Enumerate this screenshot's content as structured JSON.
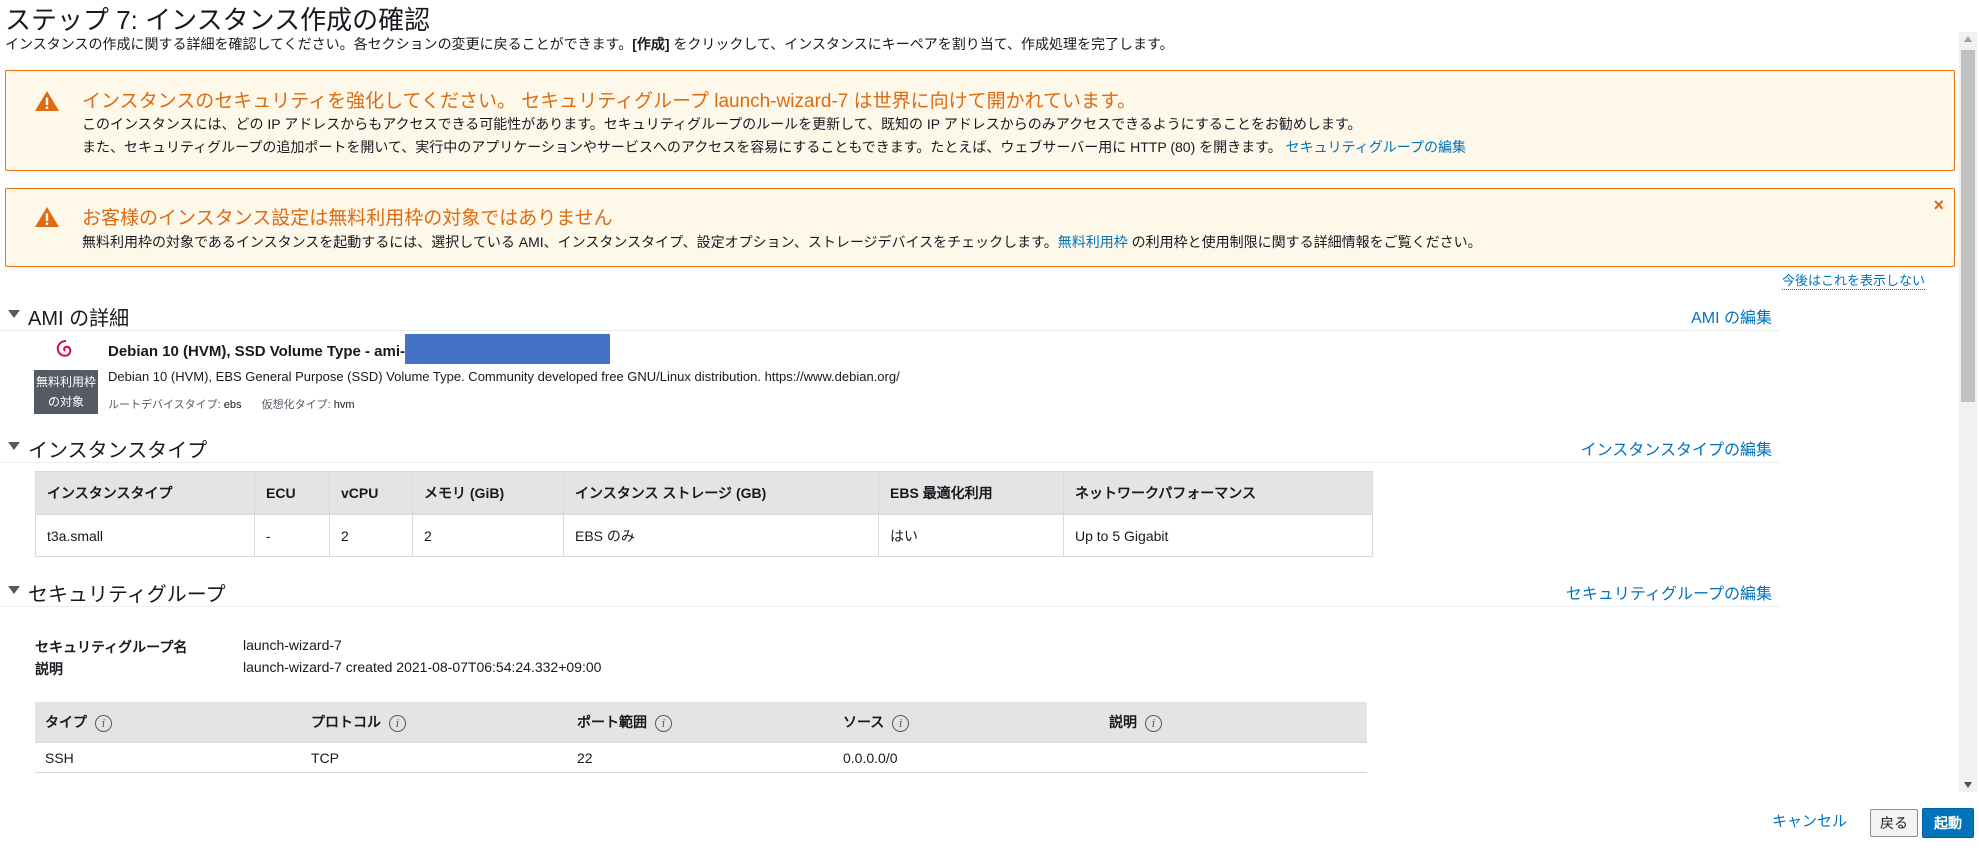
{
  "page": {
    "title": "ステップ 7: インスタンス作成の確認",
    "subtitle_pre": "インスタンスの作成に関する詳細を確認してください。各セクションの変更に戻ることができます。",
    "subtitle_bold": "[作成]",
    "subtitle_post": " をクリックして、インスタンスにキーペアを割り当て、作成処理を完了します。"
  },
  "alerts": {
    "security": {
      "title": "インスタンスのセキュリティを強化してください。 セキュリティグループ launch-wizard-7 は世界に向けて開かれています。",
      "line1": "このインスタンスには、どの IP アドレスからもアクセスできる可能性があります。セキュリティグループのルールを更新して、既知の IP アドレスからのみアクセスできるようにすることをお勧めします。",
      "line2": "また、セキュリティグループの追加ポートを開いて、実行中のアプリケーションやサービスへのアクセスを容易にすることもできます。たとえば、ウェブサーバー用に HTTP (80) を開きます。",
      "link": "セキュリティグループの編集"
    },
    "free_tier": {
      "title": "お客様のインスタンス設定は無料利用枠の対象ではありません",
      "line_pre": "無料利用枠の対象であるインスタンスを起動するには、選択している AMI、インスタンスタイプ、設定オプション、ストレージデバイスをチェックします。",
      "link": "無料利用枠",
      "line_post": " の利用枠と使用制限に関する詳細情報をご覧ください。",
      "close": "×",
      "dismiss": "今後はこれを表示しない"
    }
  },
  "ami": {
    "section_title": "AMI の詳細",
    "edit": "AMI の編集",
    "badge_line1": "無料利用枠",
    "badge_line2": "の対象",
    "name": "Debian 10 (HVM), SSD Volume Type - ami-",
    "description": "Debian 10 (HVM), EBS General Purpose (SSD) Volume Type. Community developed free GNU/Linux distribution. https://www.debian.org/",
    "root_label": "ルートデバイスタイプ:",
    "root_value": "ebs",
    "virt_label": "仮想化タイプ:",
    "virt_value": "hvm"
  },
  "instance_type": {
    "section_title": "インスタンスタイプ",
    "edit": "インスタンスタイプの編集",
    "headers": [
      "インスタンスタイプ",
      "ECU",
      "vCPU",
      "メモリ (GiB)",
      "インスタンス ストレージ (GB)",
      "EBS 最適化利用",
      "ネットワークパフォーマンス"
    ],
    "row": [
      "t3a.small",
      "-",
      "2",
      "2",
      "EBS のみ",
      "はい",
      "Up to 5 Gigabit"
    ]
  },
  "security_group": {
    "section_title": "セキュリティグループ",
    "edit": "セキュリティグループの編集",
    "name_label": "セキュリティグループ名",
    "name_value": "launch-wizard-7",
    "desc_label": "説明",
    "desc_value": "launch-wizard-7 created 2021-08-07T06:54:24.332+09:00",
    "headers": [
      "タイプ",
      "プロトコル",
      "ポート範囲",
      "ソース",
      "説明"
    ],
    "row": [
      "SSH",
      "TCP",
      "22",
      "0.0.0.0/0",
      ""
    ]
  },
  "footer": {
    "cancel": "キャンセル",
    "back": "戻る",
    "launch": "起動"
  },
  "colors": {
    "warning": "#dd6b10",
    "warning_bg": "#fef8eb",
    "link": "#0073bb",
    "primary": "#0073bb"
  },
  "icons": [
    "warning-icon",
    "close-icon",
    "caret-down-icon",
    "debian-logo-icon",
    "info-icon"
  ]
}
